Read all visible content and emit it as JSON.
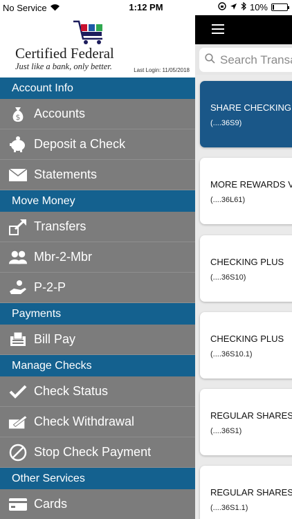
{
  "status_bar": {
    "carrier": "No Service",
    "time": "1:12 PM",
    "battery": "10%",
    "battery_level": 0.1
  },
  "logo": {
    "name": "Certified Federal",
    "tagline": "Just like a bank, only better.",
    "last_login": "Last Login:  11/05/2018"
  },
  "menu": {
    "account_info": "Account Info",
    "accounts": "Accounts",
    "deposit": "Deposit a Check",
    "statements": "Statements",
    "move_money": "Move Money",
    "transfers": "Transfers",
    "mbr2mbr": "Mbr-2-Mbr",
    "p2p": "P-2-P",
    "payments": "Payments",
    "bill_pay": "Bill Pay",
    "manage_checks": "Manage Checks",
    "check_status": "Check Status",
    "check_withdrawal": "Check Withdrawal",
    "stop_check": "Stop Check Payment",
    "other_services": "Other Services",
    "cards": "Cards"
  },
  "search": {
    "placeholder": "Search Transactions"
  },
  "accounts": [
    {
      "name": "SHARE CHECKING",
      "number": "(....36S9)"
    },
    {
      "name": "MORE REWARDS VISA",
      "number": "(....36L61)"
    },
    {
      "name": "CHECKING PLUS",
      "number": "(....36S10)"
    },
    {
      "name": "CHECKING PLUS",
      "number": "(....36S10.1)"
    },
    {
      "name": "REGULAR SHARES",
      "number": "(....36S1)"
    },
    {
      "name": "REGULAR SHARES",
      "number": "(....36S1.1)"
    }
  ],
  "colors": {
    "section_header": "#14618f",
    "drawer_bg": "#7c7c7c",
    "selected_card": "#1a5788"
  }
}
